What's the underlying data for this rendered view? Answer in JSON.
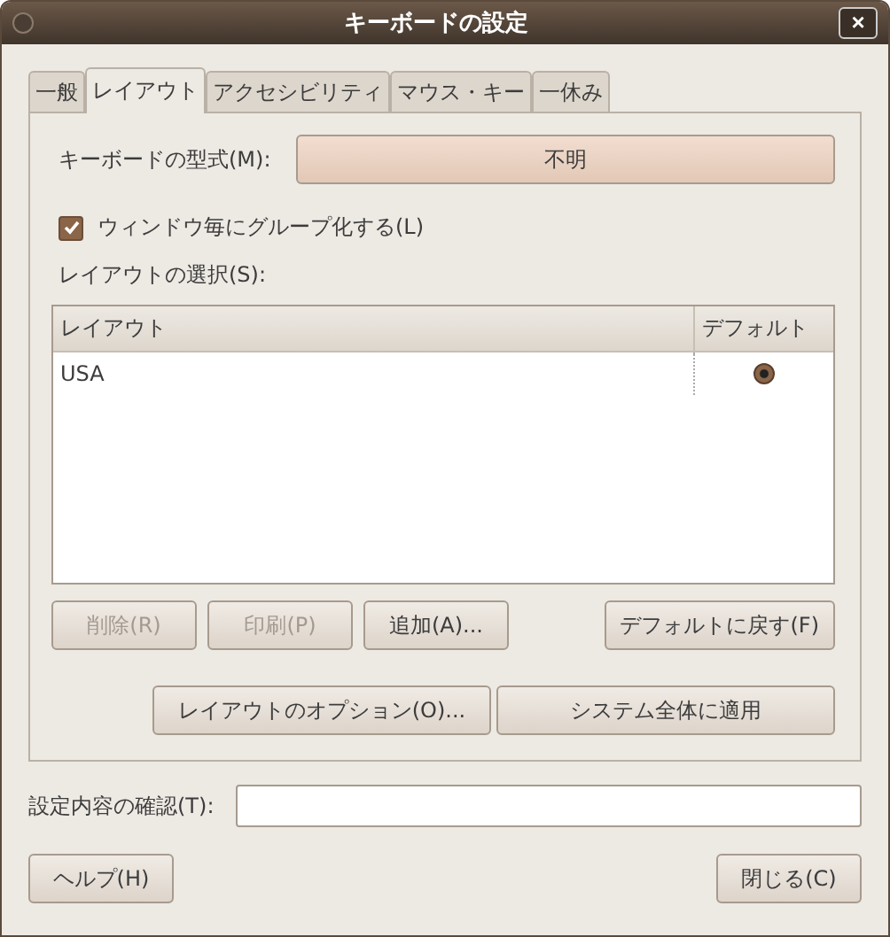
{
  "window": {
    "title": "キーボードの設定",
    "close": "×"
  },
  "tabs": [
    {
      "label": "一般",
      "selected": false
    },
    {
      "label": "レイアウト",
      "selected": true
    },
    {
      "label": "アクセシビリティ",
      "selected": false
    },
    {
      "label": "マウス・キー",
      "selected": false
    },
    {
      "label": "一休み",
      "selected": false
    }
  ],
  "keyboard_model": {
    "label": "キーボードの型式(M):",
    "value": "不明"
  },
  "group_per_window": {
    "label": "ウィンドウ毎にグループ化する(L)",
    "checked": true
  },
  "layout_selection": {
    "label": "レイアウトの選択(S):",
    "columns": [
      "レイアウト",
      "デフォルト"
    ],
    "rows": [
      {
        "name": "USA",
        "selected": true
      }
    ]
  },
  "list_buttons": [
    {
      "label": "削除(R)",
      "disabled": true
    },
    {
      "label": "印刷(P)",
      "disabled": true
    },
    {
      "label": "追加(A)...",
      "disabled": false
    },
    {
      "label": "デフォルトに戻す(F)",
      "disabled": false
    }
  ],
  "option_buttons": [
    {
      "label": "レイアウトのオプション(O)..."
    },
    {
      "label": "システム全体に適用"
    }
  ],
  "test_field": {
    "label": "設定内容の確認(T):"
  },
  "footer_buttons": [
    {
      "label": "ヘルプ(H)"
    },
    {
      "label": "閉じる(C)"
    }
  ]
}
